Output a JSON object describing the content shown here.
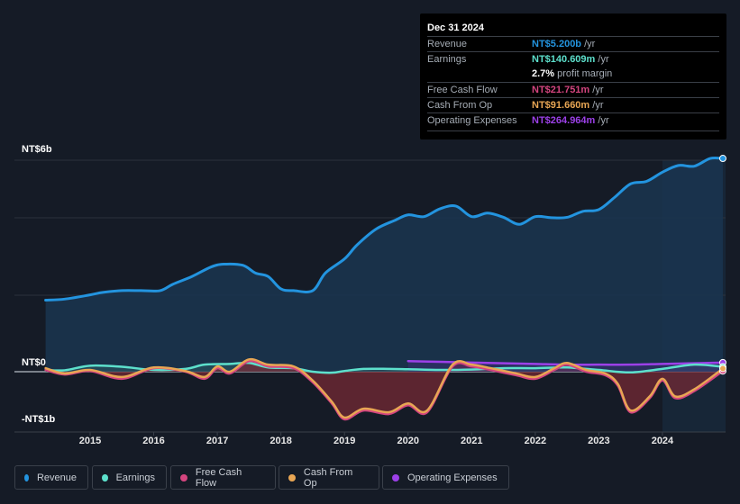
{
  "tooltip": {
    "date": "Dec 31 2024",
    "rows": [
      {
        "label": "Revenue",
        "value": "NT$5.200b",
        "unit": " /yr",
        "color": "#2394df"
      },
      {
        "label": "Earnings",
        "value": "NT$140.609m",
        "unit": " /yr",
        "color": "#5de0cc"
      },
      {
        "label": "Free Cash Flow",
        "value": "NT$21.751m",
        "unit": " /yr",
        "color": "#d4457f"
      },
      {
        "label": "Cash From Op",
        "value": "NT$91.660m",
        "unit": " /yr",
        "color": "#e8a654"
      },
      {
        "label": "Operating Expenses",
        "value": "NT$264.964m",
        "unit": " /yr",
        "color": "#9c40e8"
      }
    ],
    "margin_value": "2.7%",
    "margin_text": " profit margin"
  },
  "chart_data": {
    "type": "line",
    "title": "",
    "xlabel": "",
    "ylabel": "",
    "y_tick_labels": [
      "NT$6b",
      "NT$0",
      "-NT$1b"
    ],
    "x_tick_labels": [
      "2015",
      "2016",
      "2017",
      "2018",
      "2019",
      "2020",
      "2021",
      "2022",
      "2023",
      "2024"
    ],
    "xlim": [
      2014.0,
      2025.0
    ],
    "ylim": [
      -1.65,
      6.0
    ],
    "grid": true,
    "legend_position": "bottom",
    "series": [
      {
        "name": "Revenue",
        "color": "#2394df",
        "x": [
          2014.3,
          2014.6,
          2015.0,
          2015.2,
          2015.5,
          2015.8,
          2016.1,
          2016.3,
          2016.6,
          2016.9,
          2017.1,
          2017.4,
          2017.6,
          2017.8,
          2018.0,
          2018.2,
          2018.5,
          2018.7,
          2019.0,
          2019.2,
          2019.5,
          2019.8,
          2020.0,
          2020.25,
          2020.5,
          2020.75,
          2021.0,
          2021.25,
          2021.5,
          2021.75,
          2022.0,
          2022.25,
          2022.5,
          2022.75,
          2023.0,
          2023.25,
          2023.5,
          2023.75,
          2024.0,
          2024.25,
          2024.5,
          2024.75,
          2024.95
        ],
        "values": [
          2.03,
          2.06,
          2.18,
          2.25,
          2.3,
          2.3,
          2.3,
          2.48,
          2.7,
          2.97,
          3.05,
          3.02,
          2.8,
          2.7,
          2.35,
          2.3,
          2.3,
          2.8,
          3.2,
          3.6,
          4.05,
          4.3,
          4.45,
          4.4,
          4.62,
          4.7,
          4.4,
          4.5,
          4.38,
          4.18,
          4.4,
          4.37,
          4.38,
          4.55,
          4.6,
          4.95,
          5.33,
          5.4,
          5.66,
          5.85,
          5.83,
          6.05,
          6.05
        ]
      },
      {
        "name": "Earnings",
        "color": "#5de0cc",
        "x": [
          2014.3,
          2014.6,
          2015.0,
          2015.5,
          2016.0,
          2016.5,
          2016.8,
          2017.2,
          2017.5,
          2017.8,
          2018.2,
          2018.5,
          2018.8,
          2019.0,
          2019.3,
          2019.7,
          2020.0,
          2020.5,
          2021.0,
          2021.5,
          2022.0,
          2022.5,
          2023.0,
          2023.5,
          2024.0,
          2024.5,
          2024.95
        ],
        "values": [
          0.05,
          0.04,
          0.17,
          0.14,
          0.05,
          0.08,
          0.2,
          0.22,
          0.25,
          0.12,
          0.1,
          0.0,
          -0.03,
          0.02,
          0.08,
          0.08,
          0.07,
          0.05,
          0.06,
          0.1,
          0.1,
          0.12,
          0.05,
          -0.02,
          0.08,
          0.2,
          0.14
        ]
      },
      {
        "name": "Free Cash Flow",
        "color": "#d4457f",
        "x": [
          2014.3,
          2014.6,
          2015.0,
          2015.5,
          2016.0,
          2016.5,
          2016.8,
          2017.0,
          2017.2,
          2017.5,
          2017.8,
          2018.2,
          2018.5,
          2018.8,
          2019.0,
          2019.3,
          2019.7,
          2020.0,
          2020.3,
          2020.7,
          2021.0,
          2021.3,
          2021.7,
          2022.0,
          2022.3,
          2022.5,
          2022.8,
          2023.1,
          2023.3,
          2023.5,
          2023.8,
          2024.0,
          2024.2,
          2024.5,
          2024.95
        ],
        "values": [
          0.05,
          -0.08,
          0.02,
          -0.2,
          0.1,
          0.0,
          -0.2,
          0.1,
          -0.05,
          0.3,
          0.15,
          0.1,
          -0.3,
          -0.9,
          -1.35,
          -1.1,
          -1.2,
          -0.95,
          -1.15,
          0.15,
          0.15,
          0.05,
          -0.1,
          -0.2,
          0.05,
          0.2,
          0.0,
          -0.1,
          -0.4,
          -1.15,
          -0.75,
          -0.25,
          -0.75,
          -0.55,
          0.02
        ]
      },
      {
        "name": "Cash From Op",
        "color": "#e8a654",
        "x": [
          2014.3,
          2014.6,
          2015.0,
          2015.5,
          2016.0,
          2016.5,
          2016.8,
          2017.0,
          2017.2,
          2017.5,
          2017.8,
          2018.2,
          2018.5,
          2018.8,
          2019.0,
          2019.3,
          2019.7,
          2020.0,
          2020.3,
          2020.7,
          2021.0,
          2021.3,
          2021.7,
          2022.0,
          2022.3,
          2022.5,
          2022.8,
          2023.1,
          2023.3,
          2023.5,
          2023.8,
          2024.0,
          2024.2,
          2024.5,
          2024.95
        ],
        "values": [
          0.1,
          -0.05,
          0.05,
          -0.15,
          0.12,
          0.02,
          -0.15,
          0.15,
          0.0,
          0.35,
          0.2,
          0.15,
          -0.25,
          -0.85,
          -1.3,
          -1.05,
          -1.15,
          -0.9,
          -1.1,
          0.2,
          0.2,
          0.1,
          -0.05,
          -0.15,
          0.1,
          0.25,
          0.05,
          -0.05,
          -0.35,
          -1.1,
          -0.7,
          -0.2,
          -0.7,
          -0.5,
          0.09
        ]
      },
      {
        "name": "Operating Expenses",
        "color": "#9c40e8",
        "x": [
          2020.0,
          2020.5,
          2021.0,
          2021.5,
          2022.0,
          2022.5,
          2023.0,
          2023.5,
          2024.0,
          2024.5,
          2024.95
        ],
        "values": [
          0.3,
          0.28,
          0.26,
          0.24,
          0.22,
          0.2,
          0.2,
          0.2,
          0.22,
          0.24,
          0.26
        ]
      }
    ]
  },
  "legend": [
    {
      "label": "Revenue",
      "color": "#2394df"
    },
    {
      "label": "Earnings",
      "color": "#5de0cc"
    },
    {
      "label": "Free Cash Flow",
      "color": "#d4457f"
    },
    {
      "label": "Cash From Op",
      "color": "#e8a654"
    },
    {
      "label": "Operating Expenses",
      "color": "#9c40e8"
    }
  ]
}
